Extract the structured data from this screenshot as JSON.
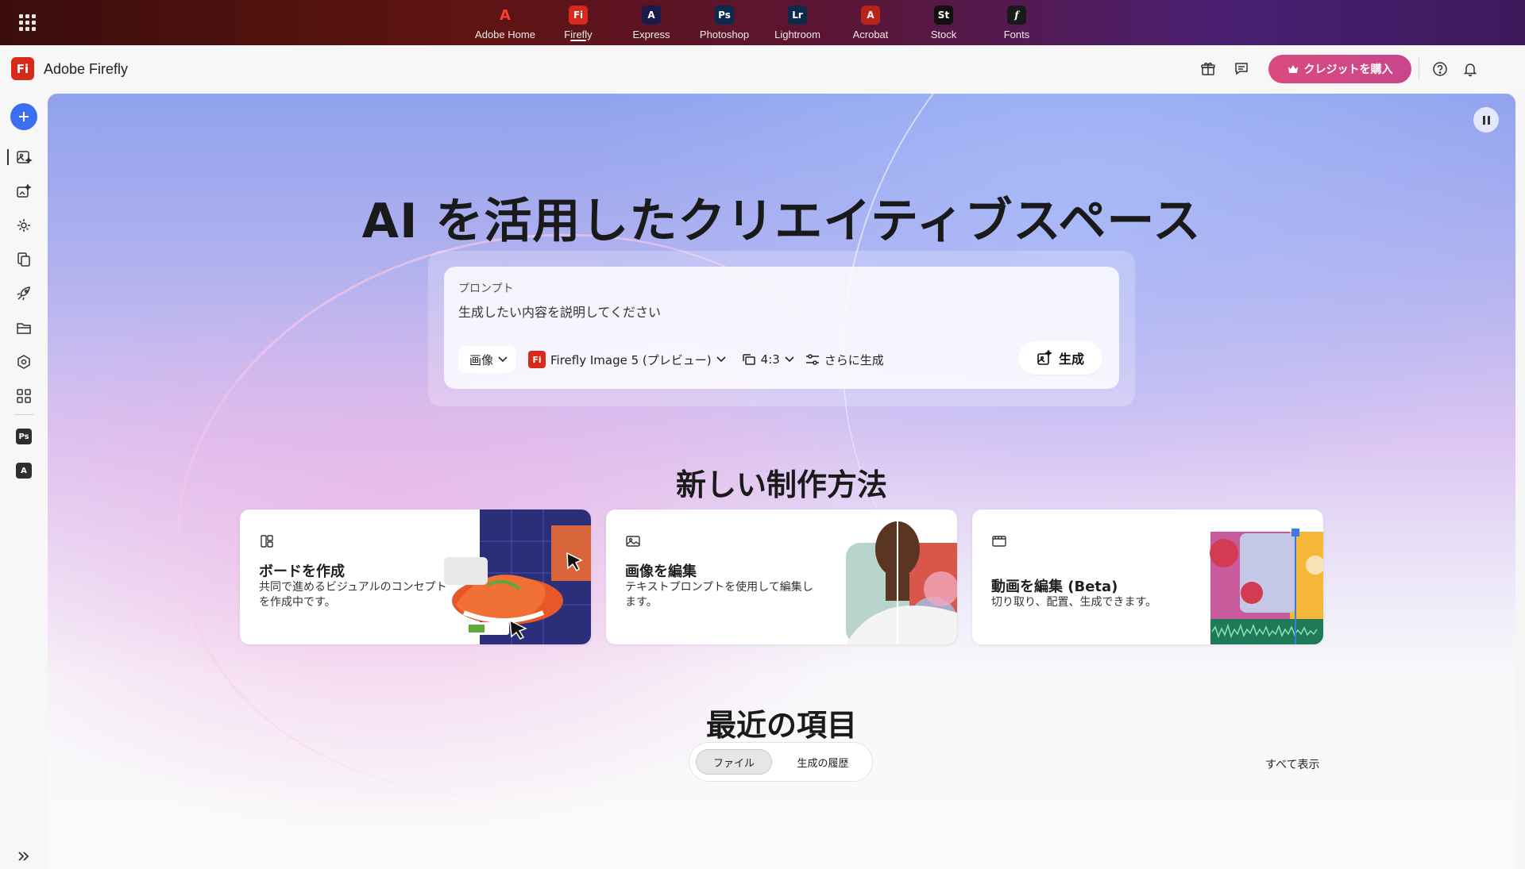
{
  "appbar": {
    "apps": [
      {
        "label": "Adobe Home",
        "icon": "adobe-icon",
        "color": "#ff3b2f",
        "glyph": "A"
      },
      {
        "label": "Firefly",
        "icon": "firefly-icon",
        "color": "#d7291c",
        "glyph": "Fi",
        "active": true
      },
      {
        "label": "Express",
        "icon": "express-icon",
        "color": "#1b1b4a",
        "glyph": "A"
      },
      {
        "label": "Photoshop",
        "icon": "photoshop-icon",
        "color": "#0b2a4f",
        "glyph": "Ps"
      },
      {
        "label": "Lightroom",
        "icon": "lightroom-icon",
        "color": "#0d2a4a",
        "glyph": "Lr"
      },
      {
        "label": "Acrobat",
        "icon": "acrobat-icon",
        "color": "#b8231b",
        "glyph": "A"
      },
      {
        "label": "Stock",
        "icon": "stock-icon",
        "color": "#111111",
        "glyph": "St"
      },
      {
        "label": "Fonts",
        "icon": "fonts-icon",
        "color": "#1a1a1a",
        "glyph": "f"
      }
    ]
  },
  "header": {
    "logo": "Fi",
    "brand": "Adobe Firefly",
    "buy_label": "クレジットを購入",
    "accent": "#d94a7e"
  },
  "hero": {
    "title": "AI を活用したクリエイティブスペース"
  },
  "prompt": {
    "label": "プロンプト",
    "placeholder": "生成したい内容を説明してください",
    "type": "画像",
    "model_badge": "Fi",
    "model": "Firefly Image 5 (プレビュー)",
    "ratio": "4:3",
    "more": "さらに生成",
    "generate": "生成"
  },
  "new_ways": {
    "title": "新しい制作方法",
    "cards": [
      {
        "title": "ボードを作成",
        "desc": "共同で進めるビジュアルのコンセプトを作成中です。",
        "icon": "board-icon"
      },
      {
        "title": "画像を編集",
        "desc": "テキストプロンプトを使用して編集します。",
        "icon": "image-icon"
      },
      {
        "title": "動画を編集 (Beta)",
        "desc": "切り取り、配置、生成できます。",
        "icon": "video-icon"
      }
    ]
  },
  "recent": {
    "title": "最近の項目",
    "tabs": [
      "ファイル",
      "生成の履歴"
    ],
    "show_all": "すべて表示"
  },
  "rail": {
    "badges": [
      "Ps",
      "A"
    ]
  }
}
